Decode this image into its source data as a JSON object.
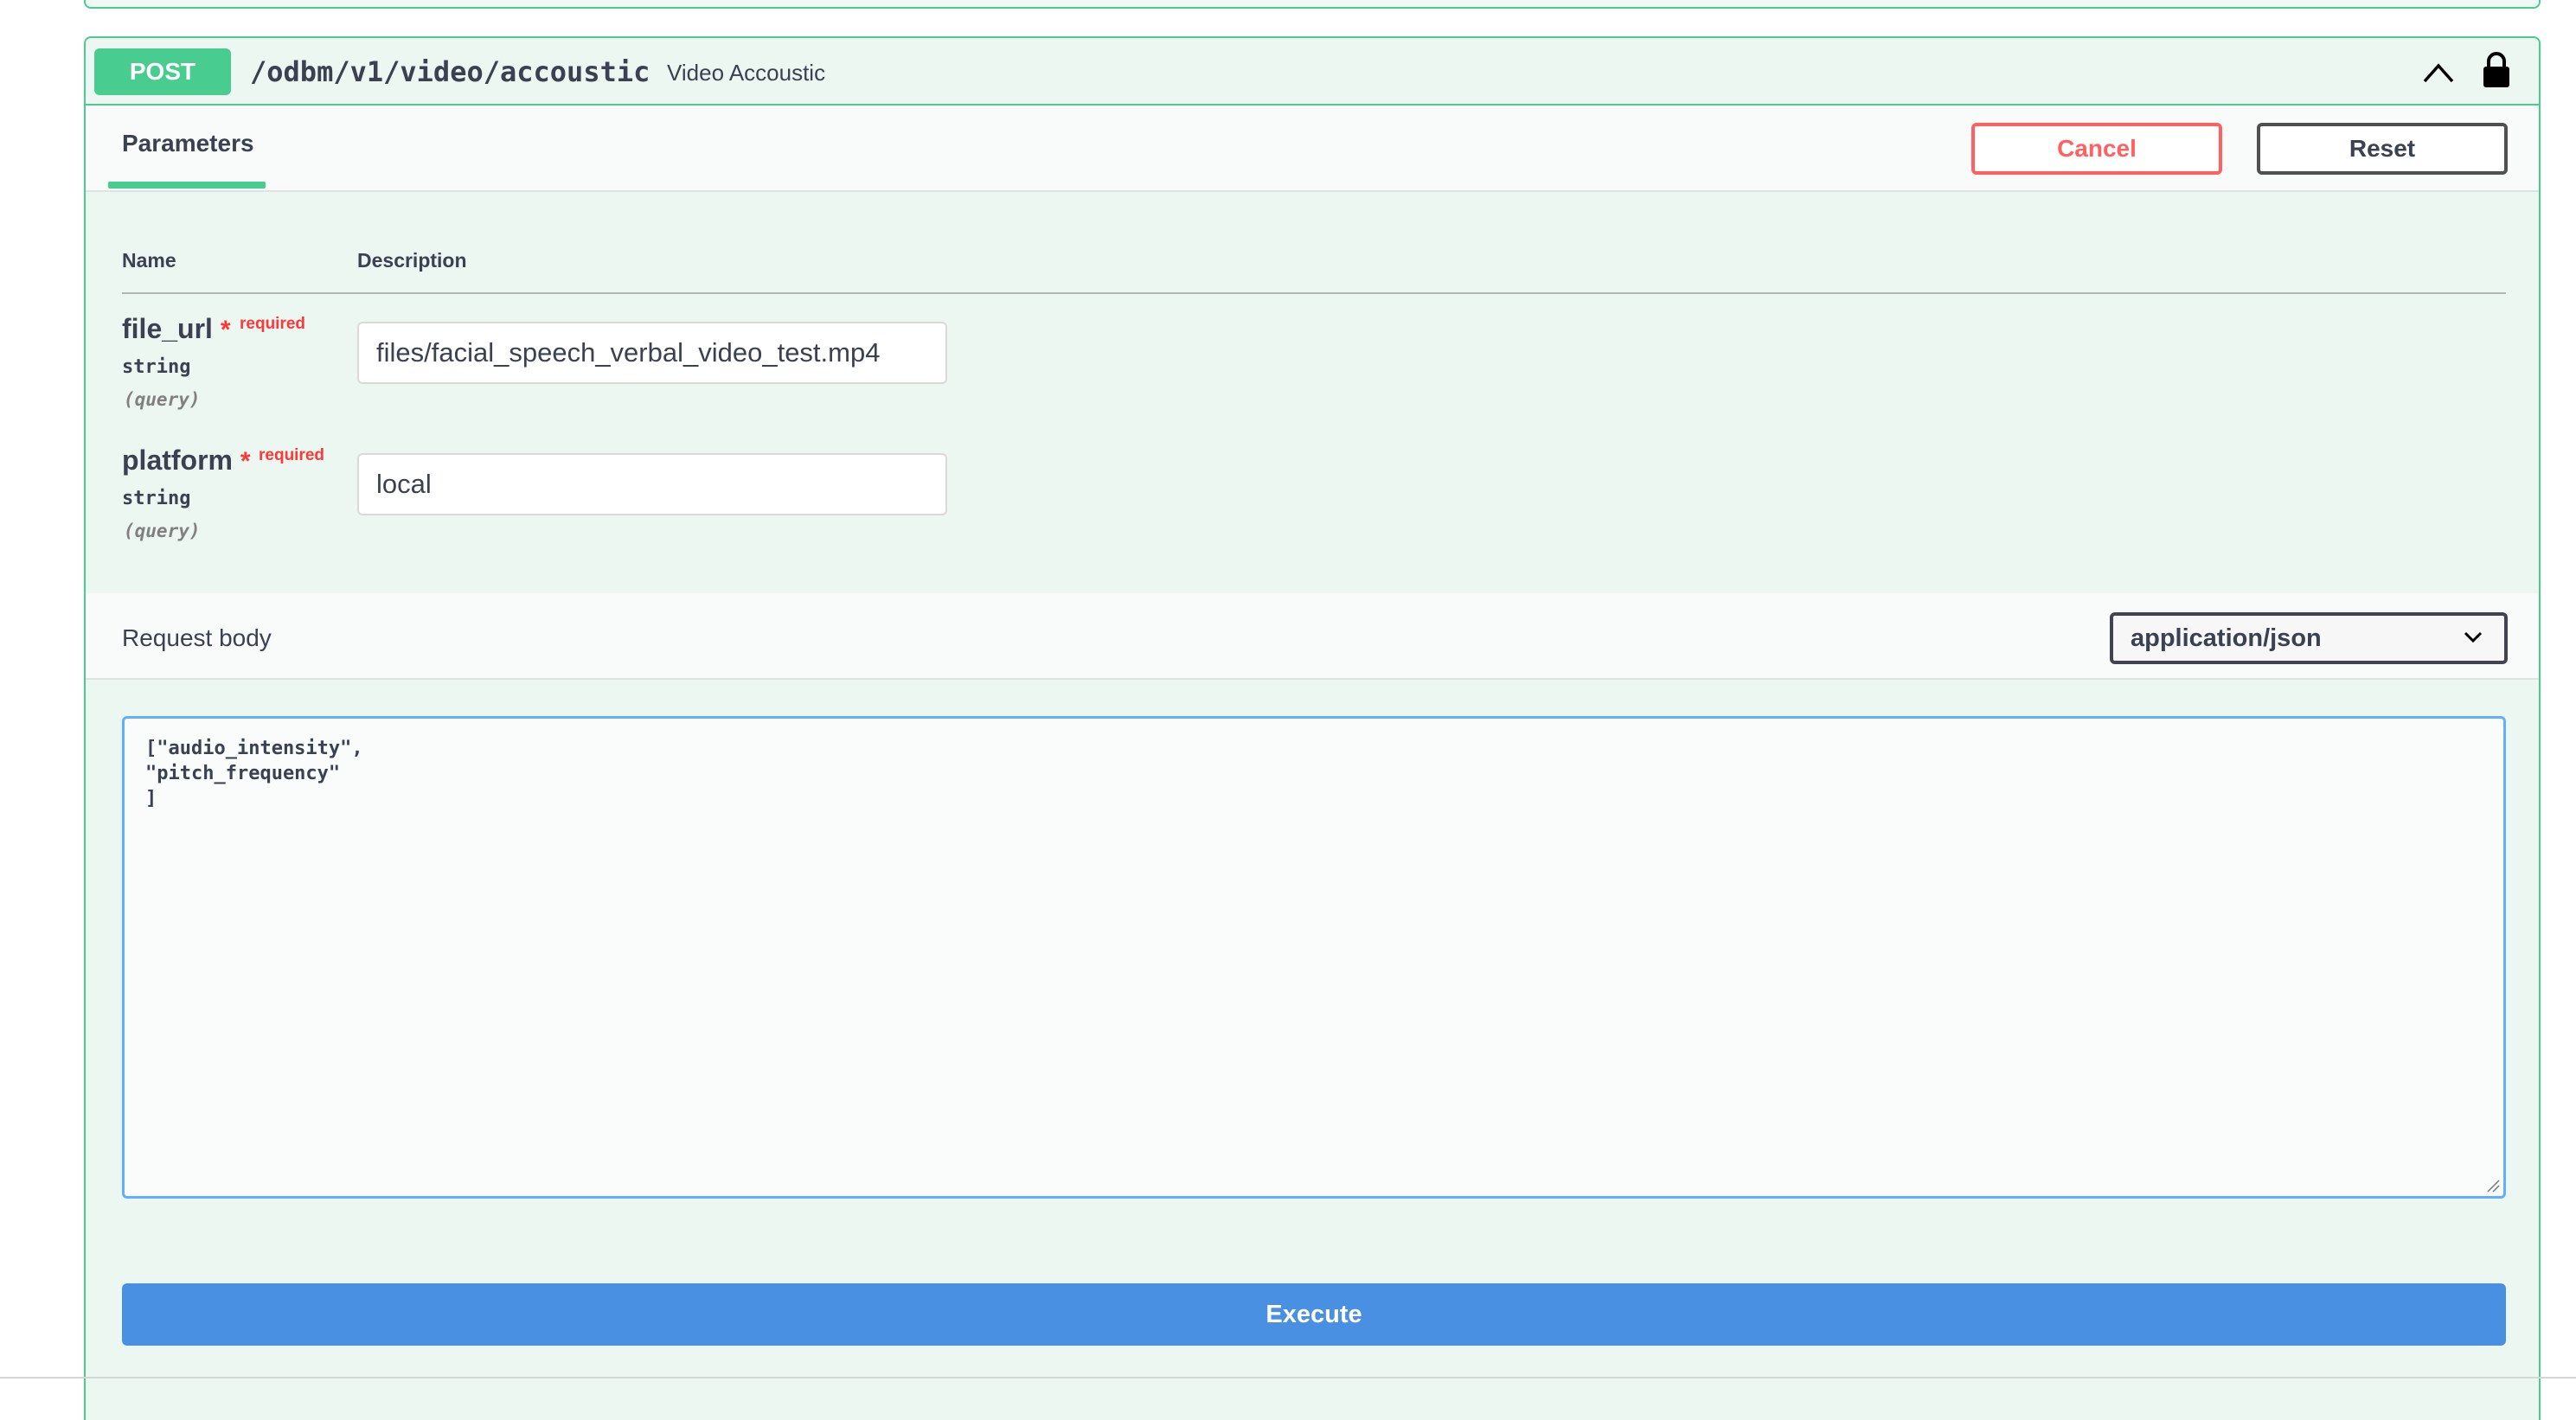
{
  "operation": {
    "method": "POST",
    "path": "/odbm/v1/video/accoustic",
    "summary": "Video Accoustic"
  },
  "tabs": {
    "parameters_label": "Parameters"
  },
  "actions": {
    "cancel_label": "Cancel",
    "reset_label": "Reset",
    "execute_label": "Execute"
  },
  "table": {
    "name_header": "Name",
    "description_header": "Description"
  },
  "parameters": [
    {
      "name": "file_url",
      "required_mark": "*",
      "required_label": "required",
      "type": "string",
      "in": "(query)",
      "value": "files/facial_speech_verbal_video_test.mp4"
    },
    {
      "name": "platform",
      "required_mark": "*",
      "required_label": "required",
      "type": "string",
      "in": "(query)",
      "value": "local"
    }
  ],
  "request_body": {
    "label": "Request body",
    "content_type": "application/json",
    "body": "[\"audio_intensity\",\n\"pitch_frequency\"\n]"
  },
  "icons": {
    "collapse": "chevron-up-icon",
    "auth": "lock-icon",
    "select": "chevron-down-icon"
  },
  "colors": {
    "post": "#49cc90",
    "cancel": "#ff6060",
    "execute": "#4990e2",
    "required": "#ff3737"
  }
}
